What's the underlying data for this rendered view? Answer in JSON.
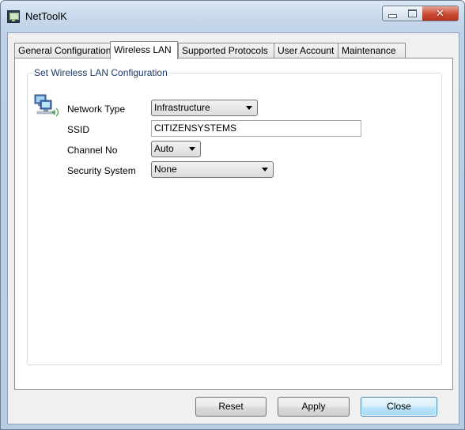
{
  "window": {
    "title": "NetToolK",
    "app_icon": "printer-network-icon",
    "controls": {
      "minimize": "minimize-icon",
      "maximize": "maximize-icon",
      "close": "close-icon",
      "close_glyph": "✕"
    }
  },
  "tabs": [
    {
      "label": "General Configuration",
      "active": false
    },
    {
      "label": "Wireless LAN",
      "active": true
    },
    {
      "label": "Supported Protocols",
      "active": false
    },
    {
      "label": "User Account",
      "active": false
    },
    {
      "label": "Maintenance",
      "active": false
    }
  ],
  "wireless": {
    "group_title": "Set Wireless LAN Configuration",
    "icon": "network-computers-icon",
    "network_type": {
      "label": "Network Type",
      "value": "Infrastructure"
    },
    "ssid": {
      "label": "SSID",
      "value": "CITIZENSYSTEMS"
    },
    "channel": {
      "label": "Channel No",
      "value": "Auto"
    },
    "security": {
      "label": "Security System",
      "value": "None"
    }
  },
  "buttons": {
    "reset": "Reset",
    "apply": "Apply",
    "close": "Close"
  },
  "colors": {
    "title_gradient": "#c7d8eb",
    "close_button": "#c94b33",
    "group_title": "#1c3a6e",
    "default_button_border": "#3c7fb1"
  }
}
